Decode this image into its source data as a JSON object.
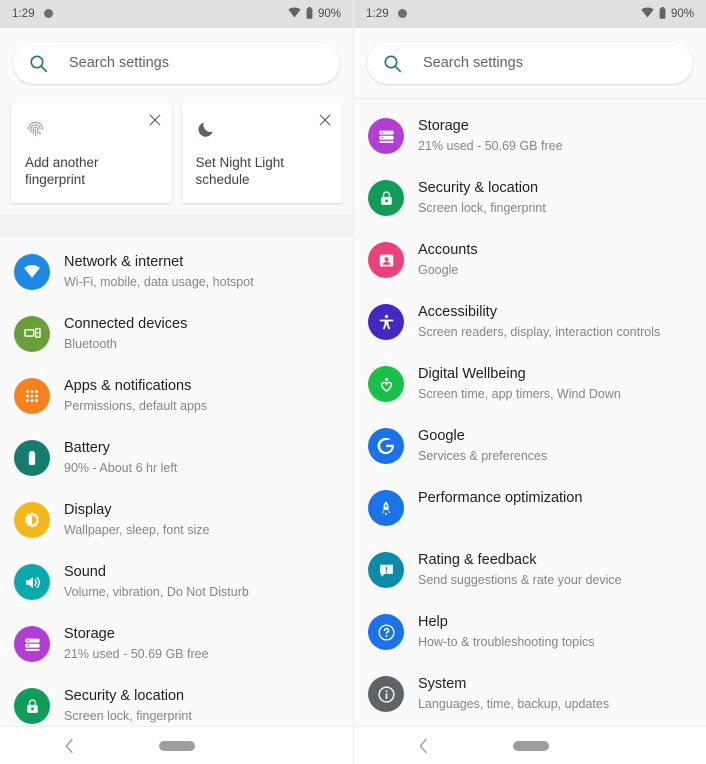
{
  "status_bar": {
    "time": "1:29",
    "notification_icon": "dot-icon",
    "wifi_icon": "wifi-icon",
    "battery_icon": "battery-icon",
    "battery_percent": "90%"
  },
  "search": {
    "placeholder": "Search settings",
    "icon": "search-icon"
  },
  "navigation_bar": {
    "back_icon": "chevron-left-icon",
    "home_pill": "home-pill-indicator"
  },
  "suggestion_cards": [
    {
      "title": "Add another fingerprint",
      "icon": "fingerprint-icon",
      "close_icon": "close-icon"
    },
    {
      "title": "Set Night Light schedule",
      "icon": "moon-icon",
      "close_icon": "close-icon"
    }
  ],
  "left_pane": {
    "items": [
      {
        "title": "Network & internet",
        "subtitle": "Wi-Fi, mobile, data usage, hotspot",
        "icon": "wifi-network-icon",
        "color": "#1e88e5"
      },
      {
        "title": "Connected devices",
        "subtitle": "Bluetooth",
        "icon": "connected-devices-icon",
        "color": "#689f38"
      },
      {
        "title": "Apps & notifications",
        "subtitle": "Permissions, default apps",
        "icon": "apps-grid-icon",
        "color": "#f4831f"
      },
      {
        "title": "Battery",
        "subtitle": "90% - About 6 hr left",
        "icon": "battery-icon",
        "color": "#147d6f"
      },
      {
        "title": "Display",
        "subtitle": "Wallpaper, sleep, font size",
        "icon": "brightness-icon",
        "color": "#f5b71a"
      },
      {
        "title": "Sound",
        "subtitle": "Volume, vibration, Do Not Disturb",
        "icon": "volume-icon",
        "color": "#0aa9ac"
      },
      {
        "title": "Storage",
        "subtitle": "21% used - 50.69 GB free",
        "icon": "storage-icon",
        "color": "#b23fd4"
      },
      {
        "title": "Security & location",
        "subtitle": "Screen lock, fingerprint",
        "icon": "lock-icon",
        "color": "#0f9d58"
      }
    ]
  },
  "right_pane": {
    "items": [
      {
        "title": "Storage",
        "subtitle": "21% used - 50.69 GB free",
        "icon": "storage-icon",
        "color": "#b23fd4"
      },
      {
        "title": "Security & location",
        "subtitle": "Screen lock, fingerprint",
        "icon": "lock-icon",
        "color": "#0f9d58"
      },
      {
        "title": "Accounts",
        "subtitle": "Google",
        "icon": "account-icon",
        "color": "#ec407a"
      },
      {
        "title": "Accessibility",
        "subtitle": "Screen readers, display, interaction controls",
        "icon": "accessibility-icon",
        "color": "#4527c4"
      },
      {
        "title": "Digital Wellbeing",
        "subtitle": "Screen time, app timers, Wind Down",
        "icon": "wellbeing-heart-icon",
        "color": "#19c04a"
      },
      {
        "title": "Google",
        "subtitle": "Services & preferences",
        "icon": "google-g-icon",
        "color": "#1a73e8"
      },
      {
        "title": "Performance optimization",
        "subtitle": "",
        "icon": "rocket-icon",
        "color": "#1a73e8"
      },
      {
        "title": "Rating & feedback",
        "subtitle": "Send suggestions & rate your device",
        "icon": "feedback-chat-icon",
        "color": "#0d8aa8"
      },
      {
        "title": "Help",
        "subtitle": "How-to & troubleshooting topics",
        "icon": "help-question-icon",
        "color": "#1a73e8"
      },
      {
        "title": "System",
        "subtitle": "Languages, time, backup, updates",
        "icon": "info-icon",
        "color": "#5f6368"
      }
    ]
  }
}
